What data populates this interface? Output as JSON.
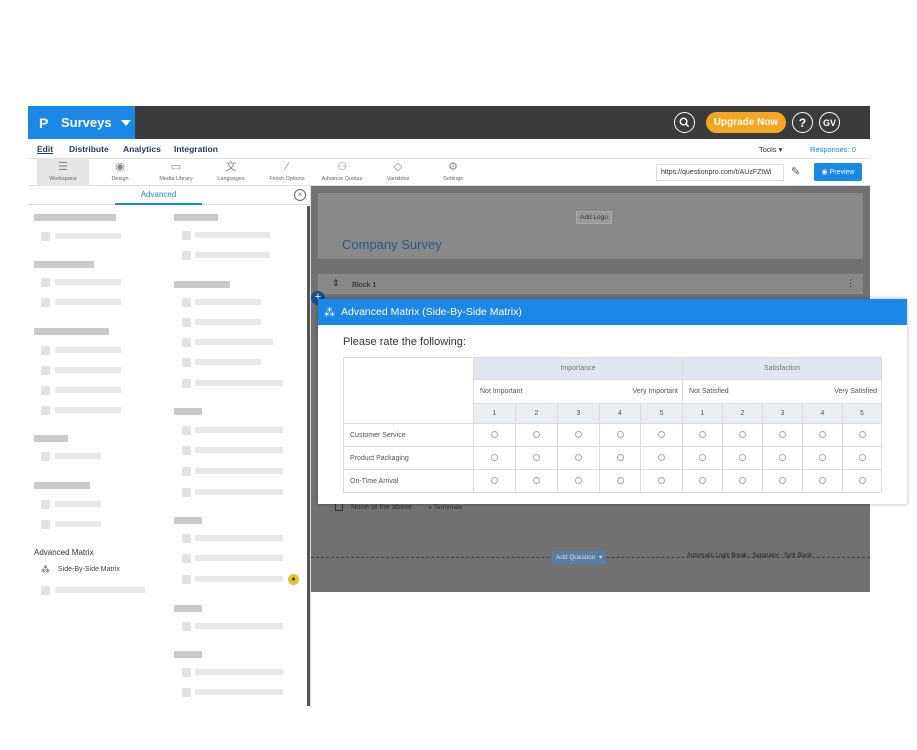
{
  "brand": {
    "logo": "P",
    "name": "Surveys"
  },
  "topbar": {
    "upgrade_label": "Upgrade Now",
    "help_label": "?",
    "avatar_initials": "GV"
  },
  "nav": {
    "items": [
      "Edit",
      "Distribute",
      "Analytics",
      "Integration"
    ],
    "tools_label": "Tools",
    "responses_label": "Responses: 0"
  },
  "toolbar": {
    "tools": [
      {
        "label": "Workspace",
        "icon": "workspace-icon"
      },
      {
        "label": "Design",
        "icon": "palette-icon"
      },
      {
        "label": "Media Library",
        "icon": "image-icon"
      },
      {
        "label": "Languages",
        "icon": "language-icon"
      },
      {
        "label": "Finish Options",
        "icon": "wand-icon"
      },
      {
        "label": "Advance Quotas",
        "icon": "quota-icon"
      },
      {
        "label": "Variables",
        "icon": "tag-icon"
      },
      {
        "label": "Settings",
        "icon": "gear-icon"
      }
    ],
    "url": "https://questionpro.com/t/AUzFZtWi",
    "preview_label": "Preview"
  },
  "left_panel": {
    "active_tab": "Advanced",
    "section_label": "Advanced Matrix",
    "matrix_item_label": "Side-By-Side Matrix"
  },
  "canvas": {
    "add_logo_label": "Add Logo",
    "survey_title": "Company Survey",
    "block_title": "Block 1",
    "none_above_label": "None of the above",
    "terminate_label": "Terminate",
    "add_question_label": "Add Question",
    "footer_links": "Automatic Logic Break  ·  Separator  ·  Split Block"
  },
  "question": {
    "header": "Advanced Matrix (Side-By-Side Matrix)",
    "text": "Please rate the following:",
    "groups": [
      {
        "title": "Importance",
        "low": "Not Important",
        "high": "Very Important"
      },
      {
        "title": "Satisfaction",
        "low": "Not Satisfied",
        "high": "Very Satisfied"
      }
    ],
    "scale": [
      "1",
      "2",
      "3",
      "4",
      "5"
    ],
    "rows": [
      "Customer Service",
      "Product Packaging",
      "On-Time Arrival"
    ]
  },
  "colors": {
    "brand_blue": "#1b87e6",
    "topbar": "#3a3b3d",
    "upgrade": "#f5a623"
  }
}
